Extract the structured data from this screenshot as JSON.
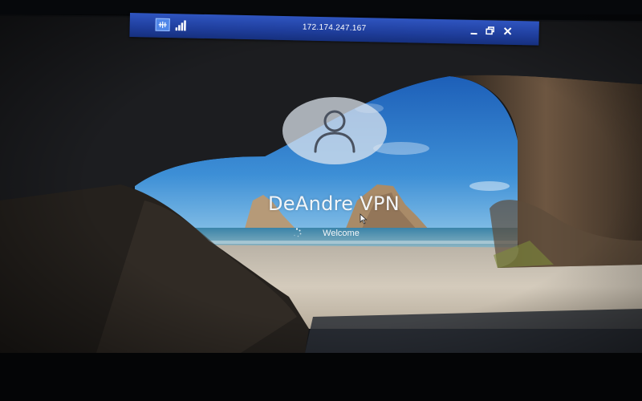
{
  "remote_desktop_bar": {
    "address": "172.174.247.167",
    "icons": {
      "pin": "pin-icon",
      "signal": "signal-strength-icon",
      "minimize": "minimize-icon",
      "restore": "restore-icon",
      "close": "close-icon"
    },
    "colors": {
      "bar": "#1f3e9c",
      "accent": "#4f86e8"
    }
  },
  "lock_screen": {
    "user_name": "DeAndre VPN",
    "status": "Welcome",
    "icons": {
      "avatar": "user-avatar-icon",
      "spinner": "loading-spinner-icon",
      "cursor": "mouse-pointer-icon"
    },
    "colors": {
      "sky": "#2f7fd0",
      "sea": "#3d8fb0",
      "sand": "#cfc6b6",
      "rock": "#6f5a44"
    }
  }
}
